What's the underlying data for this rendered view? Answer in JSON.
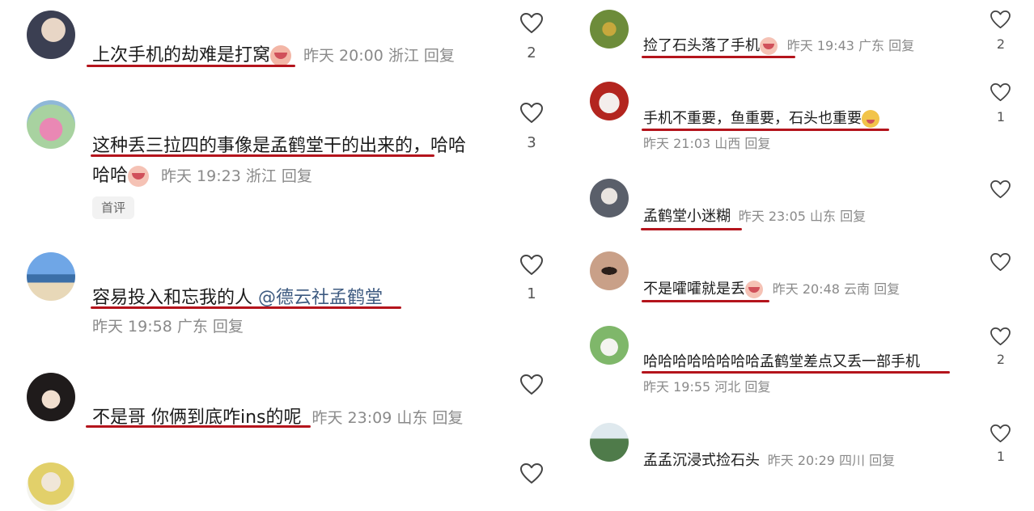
{
  "left": [
    {
      "text": "上次手机的劫难是打窝",
      "meta": "昨天 20:00 浙江 回复",
      "likes": "2"
    },
    {
      "text1": "这种丢三拉四的事像是孟鹤堂干的出来的，哈哈",
      "text2": "哈哈",
      "meta": "昨天 19:23 浙江 回复",
      "tag": "首评",
      "likes": "3"
    },
    {
      "text": "容易投入和忘我的人 ",
      "mention": "@德云社孟鹤堂",
      "meta": "昨天 19:58 广东 回复",
      "likes": "1"
    },
    {
      "text": "不是哥 你俩到底咋ins的呢",
      "meta": "昨天 23:09 山东 回复"
    }
  ],
  "right": [
    {
      "text": "捡了石头落了手机",
      "meta": "昨天 19:43 广东 回复",
      "likes": "2"
    },
    {
      "text": "手机不重要，鱼重要，石头也重要",
      "meta": "昨天 21:03 山西 回复",
      "likes": "1"
    },
    {
      "text": "孟鹤堂小迷糊",
      "meta": "昨天 23:05 山东 回复"
    },
    {
      "text": "不是嚯嚯就是丢",
      "meta": "昨天 20:48 云南 回复"
    },
    {
      "text": "哈哈哈哈哈哈哈哈孟鹤堂差点又丢一部手机",
      "meta": "昨天 19:55 河北 回复",
      "likes": "2"
    },
    {
      "text": "孟孟沉浸式捡石头",
      "meta": "昨天 20:29 四川 回复",
      "likes": "1"
    }
  ]
}
